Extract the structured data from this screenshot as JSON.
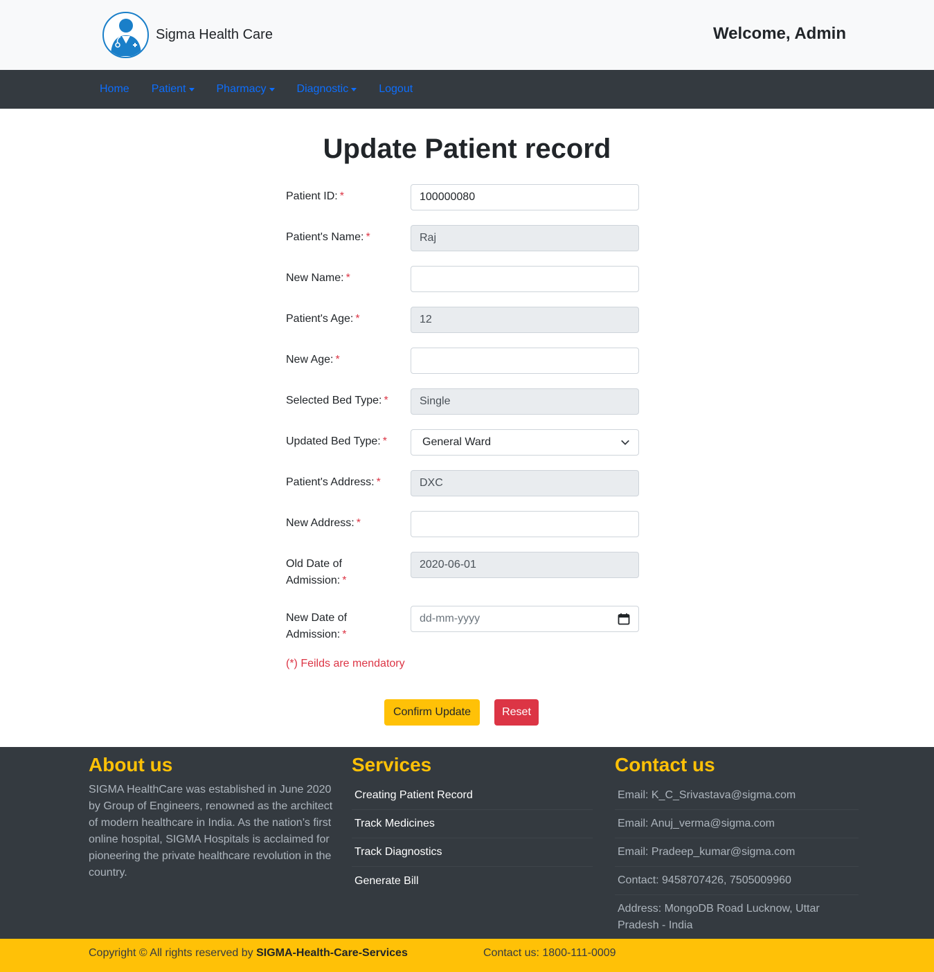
{
  "header": {
    "brand_name": "Sigma Health Care",
    "welcome": "Welcome, Admin"
  },
  "nav": {
    "home": "Home",
    "patient": "Patient",
    "pharmacy": "Pharmacy",
    "diagnostic": "Diagnostic",
    "logout": "Logout"
  },
  "form": {
    "title": "Update Patient record",
    "required_marker": "*",
    "patient_id": {
      "label": "Patient ID:",
      "value": "100000080"
    },
    "patient_name": {
      "label": "Patient's Name:",
      "value": "Raj"
    },
    "new_name": {
      "label": "New Name:",
      "value": ""
    },
    "patient_age": {
      "label": "Patient's Age:",
      "value": "12"
    },
    "new_age": {
      "label": "New Age:",
      "value": ""
    },
    "selected_bed": {
      "label": "Selected Bed Type:",
      "value": "Single"
    },
    "updated_bed": {
      "label": "Updated Bed Type:",
      "value": "General Ward"
    },
    "patient_address": {
      "label": "Patient's Address:",
      "value": "DXC"
    },
    "new_address": {
      "label": "New Address:",
      "value": ""
    },
    "old_doa": {
      "label_line1": "Old Date of",
      "label_line2": "Admission:",
      "value": "2020-06-01"
    },
    "new_doa": {
      "label_line1": "New Date of",
      "label_line2": "Admission:",
      "placeholder": "dd-mm-yyyy"
    },
    "mandatory_note": "(*) Feilds are mendatory",
    "confirm_label": "Confirm Update",
    "reset_label": "Reset"
  },
  "footer": {
    "about": {
      "title": "About us",
      "text": "SIGMA HealthCare was established in June 2020 by Group of Engineers, renowned as the architect of modern healthcare in India. As the nation’s first online hospital, SIGMA Hospitals is acclaimed for pioneering the private healthcare revolution in the country."
    },
    "services": {
      "title": "Services",
      "items": [
        "Creating Patient Record",
        "Track Medicines",
        "Track Diagnostics",
        "Generate Bill"
      ]
    },
    "contact": {
      "title": "Contact us",
      "items": [
        "Email: K_C_Srivastava@sigma.com",
        "Email: Anuj_verma@sigma.com",
        "Email: Pradeep_kumar@sigma.com",
        "Contact: 9458707426, 7505009960",
        "Address: MongoDB Road Lucknow, Uttar Pradesh - India"
      ]
    }
  },
  "copyright": {
    "prefix": "Copyright © All rights reserved by ",
    "org": "SIGMA-Health-Care-Services",
    "contact": "Contact us: 1800-111-0009"
  },
  "colors": {
    "accent": "#ffc107",
    "danger": "#dc3545",
    "link": "#0d6efd",
    "dark": "#343a40"
  }
}
